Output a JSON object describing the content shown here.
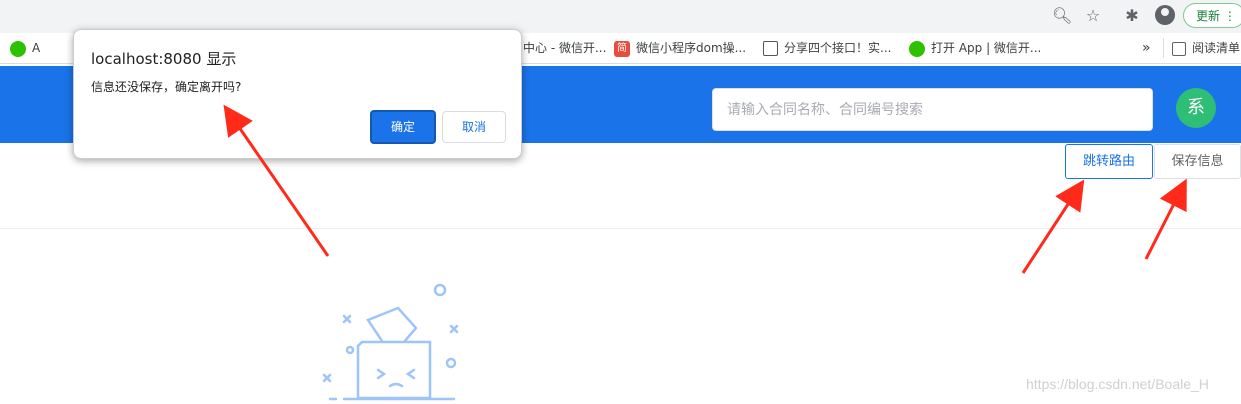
{
  "browser": {
    "update_label": "更新",
    "bookmarks": [
      {
        "label": "A",
        "icon": "wechat-icon"
      },
      {
        "label": "中心 - 微信开...",
        "icon": ""
      },
      {
        "label": "微信小程序dom操...",
        "icon": "jian-icon",
        "glyph": "简"
      },
      {
        "label": "分享四个接口！实...",
        "icon": "link-icon"
      },
      {
        "label": "打开 App | 微信开...",
        "icon": "wechat-icon"
      },
      {
        "label": "阅读清单",
        "icon": "reading-list-icon"
      }
    ],
    "more": "»"
  },
  "header": {
    "search_placeholder": "请输入合同名称、合同编号搜索",
    "avatar_text": "系"
  },
  "toolbar": {
    "route_label": "跳转路由",
    "save_label": "保存信息"
  },
  "dialog": {
    "title": "localhost:8080 显示",
    "message": "信息还没保存，确定离开吗?",
    "ok_label": "确定",
    "cancel_label": "取消"
  },
  "watermark": "https://blog.csdn.net/Boale_H",
  "colors": {
    "primary": "#1a73e8",
    "arrow": "#ff2a1a",
    "avatar": "#2fbe75"
  }
}
